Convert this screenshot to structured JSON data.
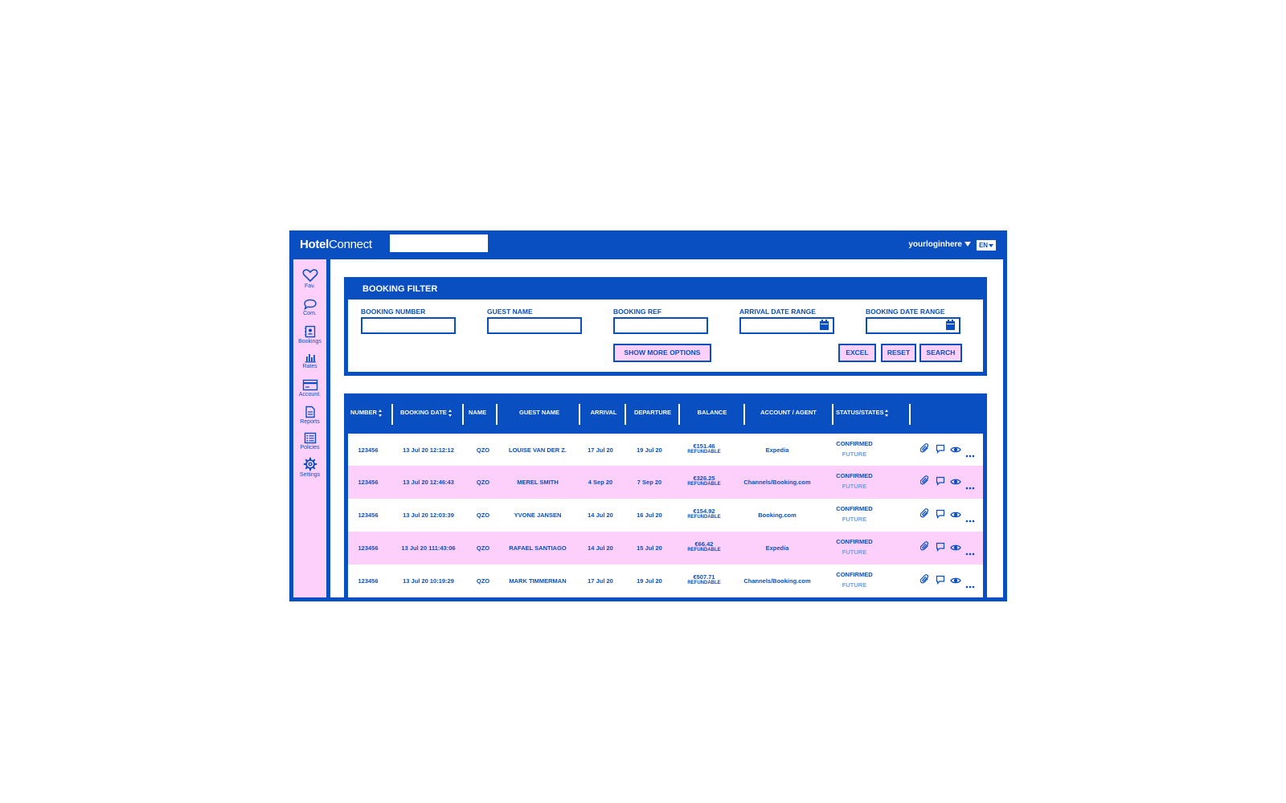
{
  "app": {
    "logo_bold": "Hotel",
    "logo_rest": "Connect"
  },
  "header": {
    "username": "yourloginhere",
    "language": "EN"
  },
  "sidebar": {
    "items": [
      {
        "label": "Fav.",
        "icon": "heart-icon"
      },
      {
        "label": "Com.",
        "icon": "chat-bubble-icon"
      },
      {
        "label": "Bookings",
        "icon": "address-book-icon"
      },
      {
        "label": "Rates",
        "icon": "bar-chart-icon"
      },
      {
        "label": "Account.",
        "icon": "credit-card-icon"
      },
      {
        "label": "Reports",
        "icon": "document-icon"
      },
      {
        "label": "Policies",
        "icon": "list-icon"
      },
      {
        "label": "Settings",
        "icon": "gear-icon"
      }
    ]
  },
  "filter": {
    "title": "BOOKING FILTER",
    "fields": {
      "booking_number": "BOOKING NUMBER",
      "guest_name": "GUEST NAME",
      "booking_ref": "BOOKING REF",
      "arrival_date_range": "ARRIVAL DATE RANGE",
      "booking_date_range": "BOOKING DATE RANGE"
    },
    "buttons": {
      "show_more": "SHOW MORE OPTIONS",
      "excel": "EXCEL",
      "reset": "RESET",
      "search": "SEARCH"
    }
  },
  "table": {
    "columns": {
      "number": "NUMBER",
      "booking_date": "BOOKING DATE",
      "name": "NAME",
      "guest_name": "GUEST NAME",
      "arrival": "ARRIVAL",
      "departure": "DEPARTURE",
      "balance": "BALANCE",
      "account_agent": "ACCOUNT / AGENT",
      "status": "STATUS/STATES"
    },
    "rows": [
      {
        "number": "123456",
        "booking_date": "13 Jul 20 12:12:12",
        "name": "QZO",
        "guest": "LOUISE VAN DER Z.",
        "arrival": "17 Jul 20",
        "departure": "19 Jul 20",
        "balance": "€151.46",
        "refund": "REFUNDABLE",
        "agent": "Expedia",
        "status": "CONFIRMED",
        "state": "FUTURE"
      },
      {
        "number": "123456",
        "booking_date": "13 Jul 20 12:46:43",
        "name": "QZO",
        "guest": "MEREL SMITH",
        "arrival": "4 Sep 20",
        "departure": "7 Sep 20",
        "balance": "€326.25",
        "refund": "REFUNDABLE",
        "agent": "Channels/Booking.com",
        "status": "CONFIRMED",
        "state": "FUTURE"
      },
      {
        "number": "123456",
        "booking_date": "13 Jul 20 12:03:39",
        "name": "QZO",
        "guest": "YVONE JANSEN",
        "arrival": "14 Jul 20",
        "departure": "16 Jul 20",
        "balance": "€154.92",
        "refund": "REFUNDABLE",
        "agent": "Booking.com",
        "status": "CONFIRMED",
        "state": "FUTURE"
      },
      {
        "number": "123456",
        "booking_date": "13 Jul 20 111:43:06",
        "name": "QZO",
        "guest": "RAFAEL SANTIAGO",
        "arrival": "14 Jul 20",
        "departure": "15 Jul 20",
        "balance": "€66.42",
        "refund": "REFUNDABLE",
        "agent": "Expedia",
        "status": "CONFIRMED",
        "state": "FUTURE"
      },
      {
        "number": "123456",
        "booking_date": "13 Jul 20 10:19:29",
        "name": "QZO",
        "guest": "MARK TIMMERMAN",
        "arrival": "17 Jul 20",
        "departure": "19 Jul 20",
        "balance": "€507.71",
        "refund": "REFUNDABLE",
        "agent": "Channels/Booking.com",
        "status": "CONFIRMED",
        "state": "FUTURE"
      }
    ],
    "row_actions": [
      "paperclip-icon",
      "comment-icon",
      "eye-icon",
      "more-dots-icon"
    ]
  },
  "colors": {
    "primary": "#0a4fc1",
    "accent": "#fdd0fb",
    "muted": "#6fa0e8",
    "background": "#ffffff"
  }
}
